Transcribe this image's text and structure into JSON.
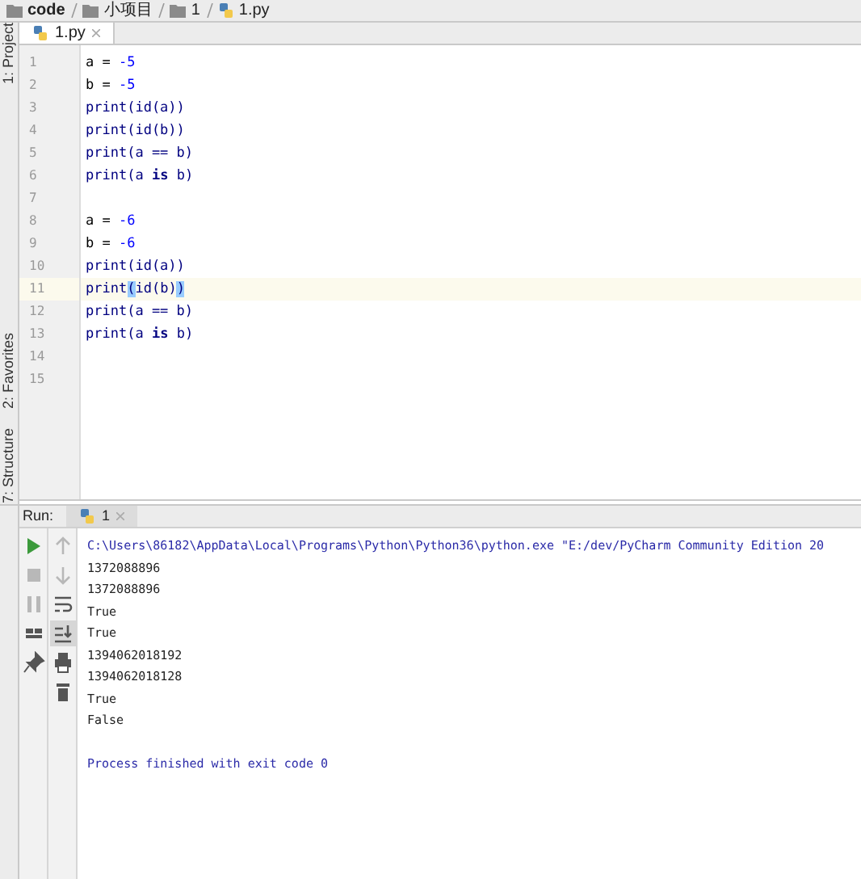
{
  "breadcrumbs": [
    {
      "label": "code",
      "kind": "folder"
    },
    {
      "label": "小项目",
      "kind": "folder"
    },
    {
      "label": "1",
      "kind": "folder"
    },
    {
      "label": "1.py",
      "kind": "file"
    }
  ],
  "side_tools_top": [
    {
      "label": "1: Project"
    }
  ],
  "side_tools_bottom": [
    {
      "label": "2: Favorites"
    },
    {
      "label": "7: Structure"
    }
  ],
  "editor_tabs": [
    {
      "label": "1.py",
      "selected": true
    }
  ],
  "code_lines": [
    {
      "number": "1",
      "current": false,
      "tokens": [
        {
          "kind": "plain",
          "text": "a = "
        },
        {
          "kind": "number",
          "text": "-5"
        }
      ]
    },
    {
      "number": "2",
      "current": false,
      "tokens": [
        {
          "kind": "plain",
          "text": "b = "
        },
        {
          "kind": "number",
          "text": "-5"
        }
      ]
    },
    {
      "number": "3",
      "current": false,
      "tokens": [
        {
          "kind": "builtin",
          "text": "print(id(a))"
        }
      ]
    },
    {
      "number": "4",
      "current": false,
      "tokens": [
        {
          "kind": "builtin",
          "text": "print(id(b))"
        }
      ]
    },
    {
      "number": "5",
      "current": false,
      "tokens": [
        {
          "kind": "builtin",
          "text": "print(a == b)"
        }
      ]
    },
    {
      "number": "6",
      "current": false,
      "tokens": [
        {
          "kind": "builtin",
          "text": "print(a "
        },
        {
          "kind": "keyword",
          "text": "is"
        },
        {
          "kind": "builtin",
          "text": " b)"
        }
      ]
    },
    {
      "number": "7",
      "current": false
    },
    {
      "number": "8",
      "current": false,
      "tokens": [
        {
          "kind": "plain",
          "text": "a = "
        },
        {
          "kind": "number",
          "text": "-6"
        }
      ]
    },
    {
      "number": "9",
      "current": false,
      "tokens": [
        {
          "kind": "plain",
          "text": "b = "
        },
        {
          "kind": "number",
          "text": "-6"
        }
      ]
    },
    {
      "number": "10",
      "current": false,
      "tokens": [
        {
          "kind": "builtin",
          "text": "print(id(a))"
        }
      ]
    },
    {
      "number": "11",
      "current": true,
      "tokens": [
        {
          "kind": "builtin",
          "text": "print"
        },
        {
          "kind": "brace_match",
          "text": "("
        },
        {
          "kind": "builtin",
          "text": "id(b)"
        },
        {
          "kind": "brace_match",
          "text": ")"
        }
      ]
    },
    {
      "number": "12",
      "current": false,
      "tokens": [
        {
          "kind": "builtin",
          "text": "print(a == b)"
        }
      ]
    },
    {
      "number": "13",
      "current": false,
      "tokens": [
        {
          "kind": "builtin",
          "text": "print(a "
        },
        {
          "kind": "keyword",
          "text": "is"
        },
        {
          "kind": "builtin",
          "text": " b)"
        }
      ]
    },
    {
      "number": "14",
      "current": false
    },
    {
      "number": "15",
      "current": false
    }
  ],
  "run_panel": {
    "label": "Run:",
    "tabs": [
      {
        "label": "1",
        "selected": true
      }
    ],
    "tools_left": [
      {
        "kind": "run",
        "disabled": false
      },
      {
        "kind": "stop",
        "disabled": true
      },
      {
        "kind": "pause",
        "disabled": true
      },
      {
        "kind": "layout",
        "disabled": false
      },
      {
        "kind": "pin",
        "disabled": false
      }
    ],
    "tools_right": [
      {
        "kind": "up",
        "disabled": true
      },
      {
        "kind": "down",
        "disabled": true
      },
      {
        "kind": "wrap",
        "disabled": false
      },
      {
        "kind": "scroll_end",
        "disabled": false
      },
      {
        "kind": "print",
        "disabled": false
      },
      {
        "kind": "trash",
        "disabled": false
      }
    ],
    "output": [
      {
        "kind": "system",
        "text": "C:\\Users\\86182\\AppData\\Local\\Programs\\Python\\Python36\\python.exe \"E:/dev/PyCharm Community Edition 20"
      },
      {
        "kind": "stdout",
        "text": "1372088896"
      },
      {
        "kind": "stdout",
        "text": "1372088896"
      },
      {
        "kind": "stdout",
        "text": "True"
      },
      {
        "kind": "stdout",
        "text": "True"
      },
      {
        "kind": "stdout",
        "text": "1394062018192"
      },
      {
        "kind": "stdout",
        "text": "1394062018128"
      },
      {
        "kind": "stdout",
        "text": "True"
      },
      {
        "kind": "stdout",
        "text": "False"
      },
      {
        "kind": "blank"
      },
      {
        "kind": "system",
        "text": "Process finished with exit code 0"
      }
    ]
  }
}
